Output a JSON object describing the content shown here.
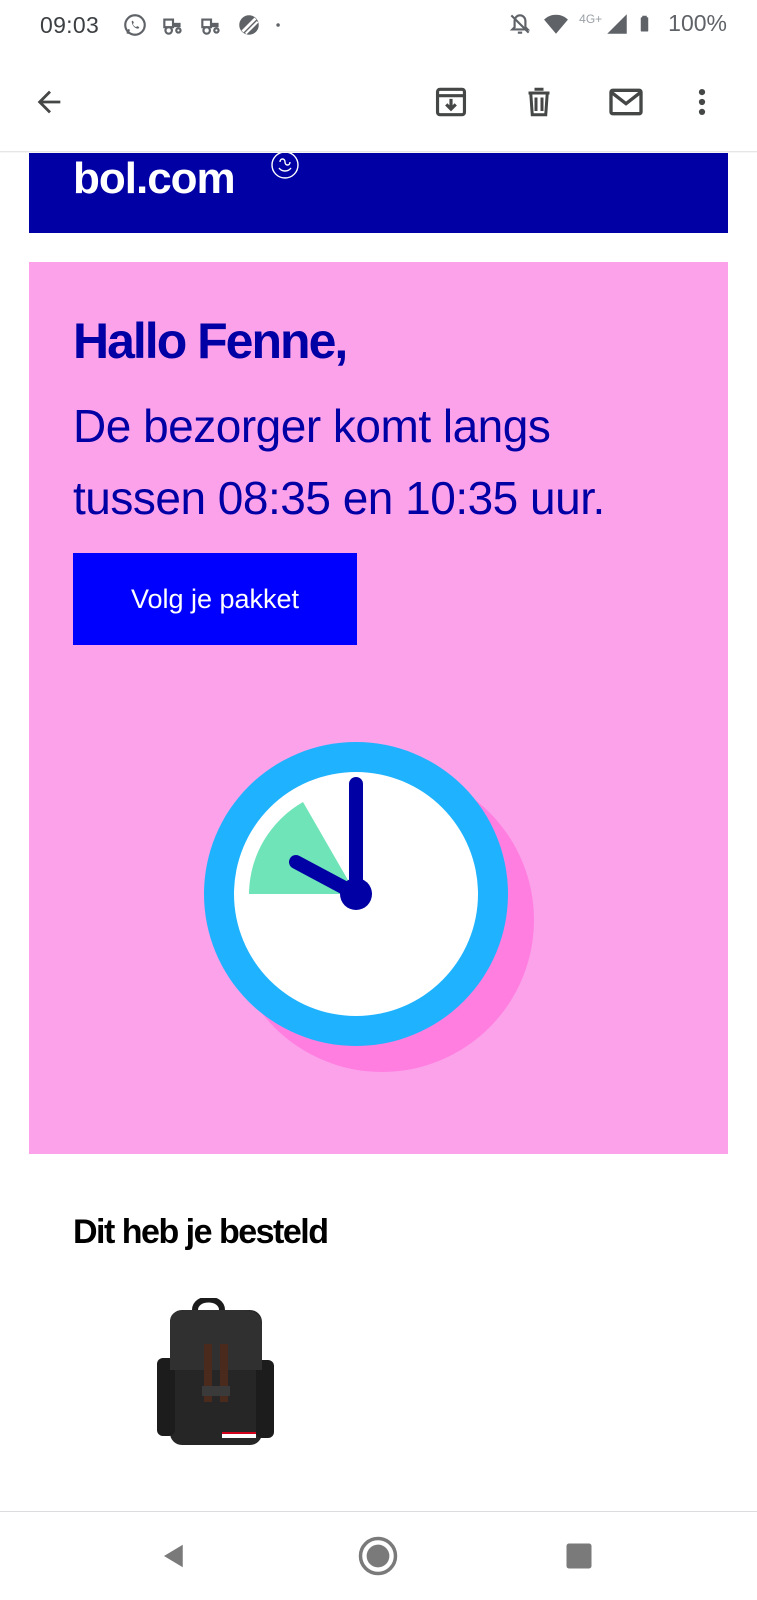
{
  "status_bar": {
    "time": "09:03",
    "battery": "100%",
    "network": "4G+",
    "icons_left": [
      "whatsapp-icon",
      "tractor-icon",
      "tractor-icon",
      "no-sim-icon",
      "dot-icon"
    ],
    "icons_right": [
      "bell-off-icon",
      "wifi-icon",
      "signal-icon",
      "battery-icon"
    ]
  },
  "app_bar": {
    "icons": [
      "back-arrow-icon",
      "archive-icon",
      "delete-icon",
      "mail-icon",
      "more-vert-icon"
    ]
  },
  "email": {
    "brand": {
      "logo_text": "bol.com",
      "background_color": "#0000a4"
    },
    "hero": {
      "greeting": "Hallo Fenne,",
      "message": "De bezorger komt langs tussen 08:35 en 10:35 uur.",
      "button_label": "Volg je pakket",
      "background_color": "#fba2eb",
      "text_color": "#0000a4",
      "button_color": "#0000ff",
      "illustration": "clock-icon"
    },
    "order": {
      "title": "Dit heb je besteld",
      "product_image": "backpack-image"
    }
  },
  "nav_bar": {
    "icons": [
      "back-triangle-icon",
      "home-circle-icon",
      "recents-square-icon"
    ]
  }
}
